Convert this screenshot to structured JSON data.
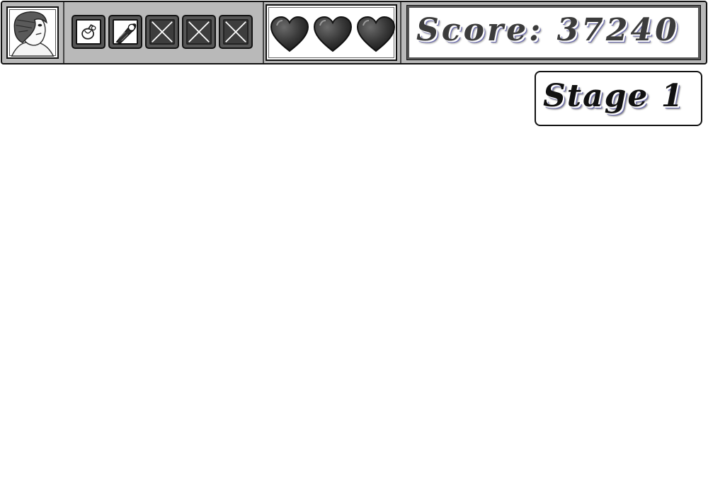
{
  "hud": {
    "avatar_icon": "player-portrait-icon",
    "inventory": [
      {
        "icon": "grenade-icon",
        "state": "filled"
      },
      {
        "icon": "rocket-icon",
        "state": "filled"
      },
      {
        "icon": "empty-slot-x-icon",
        "state": "empty"
      },
      {
        "icon": "empty-slot-x-icon",
        "state": "empty"
      },
      {
        "icon": "empty-slot-x-icon",
        "state": "empty"
      }
    ],
    "lives": 3,
    "heart_icon": "heart-icon",
    "score_label": "Score: 37240"
  },
  "stage": {
    "label": "Stage 1"
  },
  "colors": {
    "hud_background": "#b9b9b9",
    "heart": "#3a3a3a",
    "text_shadow_accent": "#6b6bb0"
  }
}
